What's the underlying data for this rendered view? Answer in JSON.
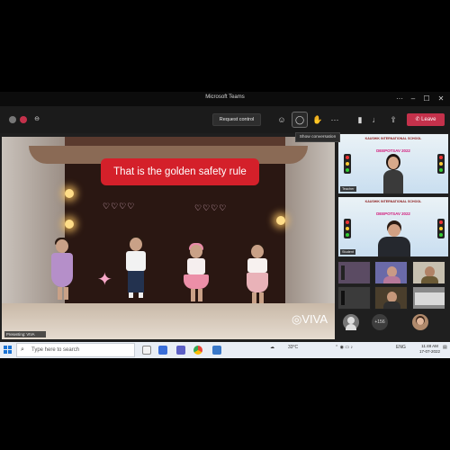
{
  "window": {
    "title": "Microsoft Teams"
  },
  "toolbar": {
    "request_control_label": "Request control",
    "chat_tooltip": "Show conversation",
    "leave_label": "Leave",
    "more_glyph": "···"
  },
  "main_video": {
    "caption": "That is the golden safety rule",
    "watermark": "VIVA",
    "presenter_tag": "Presenting: VIVA"
  },
  "gallery": {
    "tile1": {
      "school": "KAUSHIK INTERNATIONAL SCHOOL",
      "event": "DEEPOTSAV 2022",
      "participant": "Teacher"
    },
    "tile2": {
      "school": "KAUSHIK INTERNATIONAL SCHOOL",
      "event": "DEEPOTSAV 2022",
      "participant": "Student"
    },
    "more_count": "+156"
  },
  "taskbar": {
    "search_placeholder": "Type here to search",
    "weather": "33°C",
    "language": "ENG",
    "time": "11:48 AM",
    "date": "17-07-2022"
  },
  "colors": {
    "leave": "#c4314b",
    "caption_bg": "#d4202a",
    "taskbar": "#e9eef5"
  },
  "icons": [
    "close-icon",
    "maximize-icon",
    "minimize-icon",
    "chat-icon",
    "camera-icon",
    "mic-icon",
    "share-icon",
    "search-icon",
    "windows-start-icon"
  ]
}
